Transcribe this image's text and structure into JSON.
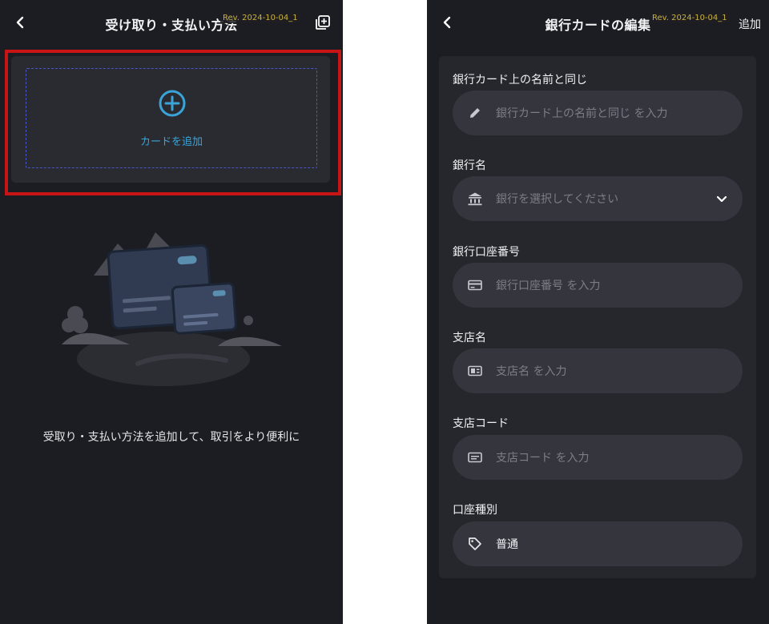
{
  "left_screen": {
    "title": "受け取り・支払い方法",
    "revision": "Rev. 2024-10-04_1",
    "add_card_label": "カードを追加",
    "empty_message": "受取り・支払い方法を追加して、取引をより便利に"
  },
  "right_screen": {
    "title": "銀行カードの編集",
    "revision": "Rev. 2024-10-04_1",
    "action_label": "追加",
    "fields": [
      {
        "label": "銀行カード上の名前と同じ",
        "placeholder": "銀行カード上の名前と同じ を入力",
        "icon": "pencil-icon"
      },
      {
        "label": "銀行名",
        "placeholder": "銀行を選択してください",
        "icon": "bank-icon"
      },
      {
        "label": "銀行口座番号",
        "placeholder": "銀行口座番号 を入力",
        "icon": "card-icon"
      },
      {
        "label": "支店名",
        "placeholder": "支店名 を入力",
        "icon": "branch-icon"
      },
      {
        "label": "支店コード",
        "placeholder": "支店コード を入力",
        "icon": "code-icon"
      },
      {
        "label": "口座種別",
        "value": "普通",
        "icon": "tag-icon"
      }
    ]
  },
  "colors": {
    "background": "#1c1d22",
    "panel": "#2a2b31",
    "field": "#34353d",
    "accent": "#3aa4d8",
    "highlight": "#c81414",
    "dashed_border": "#4a55c8"
  }
}
